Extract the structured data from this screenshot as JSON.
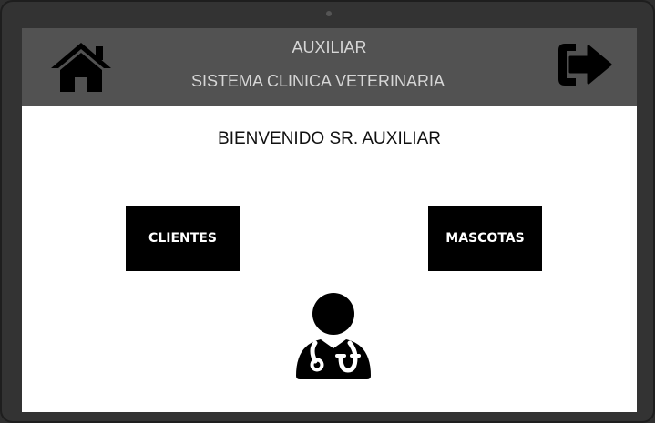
{
  "header": {
    "role_title": "AUXILIAR",
    "system_title": "SISTEMA CLINICA VETERINARIA",
    "home_icon": "home-icon",
    "logout_icon": "logout-icon"
  },
  "main": {
    "welcome_text": "BIENVENIDO SR. AUXILIAR",
    "buttons": [
      {
        "label": "CLIENTES"
      },
      {
        "label": "MASCOTAS"
      }
    ],
    "illustration_icon": "doctor-stethoscope-icon"
  },
  "colors": {
    "header_bg": "#525252",
    "header_text": "#d6d6d6",
    "button_bg": "#000000",
    "button_text": "#ffffff",
    "frame": "#333333"
  }
}
